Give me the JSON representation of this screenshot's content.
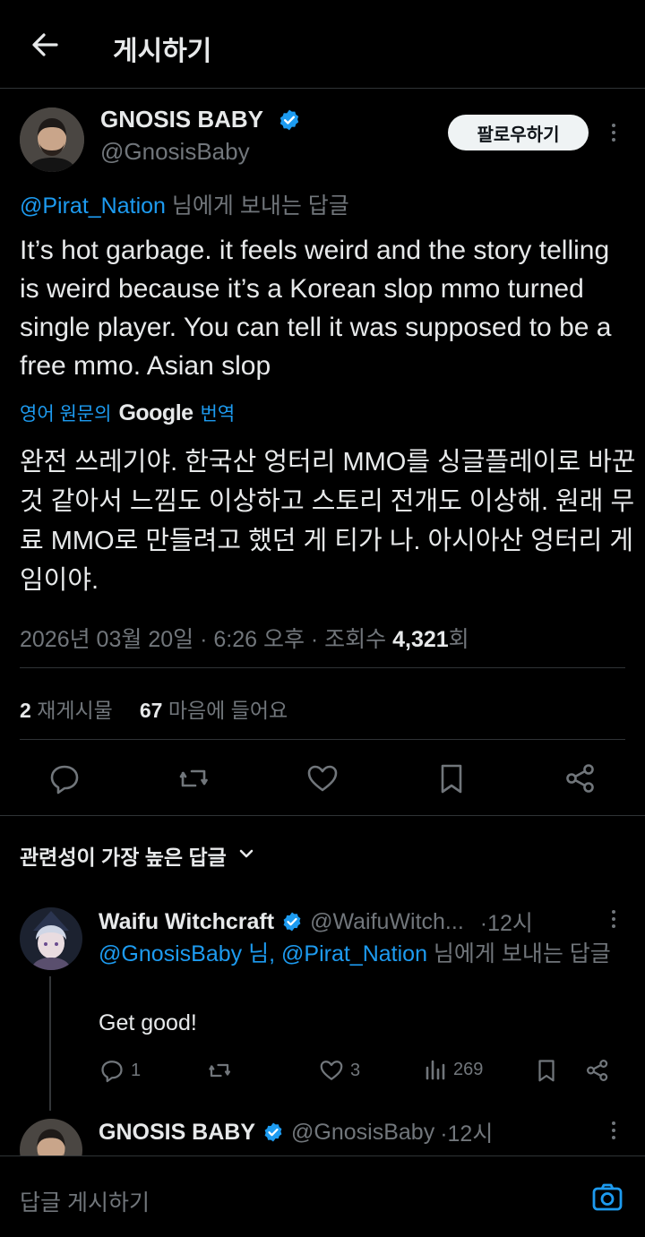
{
  "header": {
    "title": "게시하기"
  },
  "post": {
    "author_name": "GNOSIS BABY",
    "author_handle": "@GnosisBaby",
    "follow_label": "팔로우하기",
    "reply_to_handle": "@Pirat_Nation",
    "reply_to_suffix": " 님에게 보내는 답글",
    "text": "It’s hot garbage. it feels weird and the story telling is weird because it’s a Korean slop mmo turned single player. You can tell it was supposed to be a free mmo. Asian slop",
    "translate_prefix": "영어 원문의",
    "translate_brand": "Google",
    "translate_suffix": "번역",
    "translation": "완전 쓰레기야. 한국산 엉터리 MMO를 싱글플레이로 바꾼 것 같아서 느낌도 이상하고 스토리 전개도 이상해. 원래 무료 MMO로 만들려고 했던 게 티가 나. 아시아산 엉터리 게임이야.",
    "meta_date": "2026년 03월 20일 · 6:26 오후 · 조회수 ",
    "meta_views": "4,321",
    "meta_views_unit": "회",
    "reposts_count": "2",
    "reposts_label": "재게시물",
    "likes_count": "67",
    "likes_label": "마음에 들어요"
  },
  "sort": {
    "label": "관련성이 가장 높은 답글"
  },
  "replies": [
    {
      "name": "Waifu Witchcraft",
      "handle": "@WaifuWitch...",
      "time": "·12시",
      "mention1": "@GnosisBaby",
      "mid": " 님, ",
      "mention2": "@Pirat_Nation",
      "suffix": " 님에게 보내는 답글",
      "text": "Get good!",
      "replies": "1",
      "likes": "3",
      "views": "269"
    },
    {
      "name": "GNOSIS BABY",
      "handle": "@GnosisBaby",
      "time": "·12시"
    }
  ],
  "composer": {
    "placeholder": "답글 게시하기"
  },
  "colors": {
    "accent": "#1d9bf0",
    "background": "#000000",
    "muted": "#71767b",
    "verified": "#1d9bf0"
  }
}
